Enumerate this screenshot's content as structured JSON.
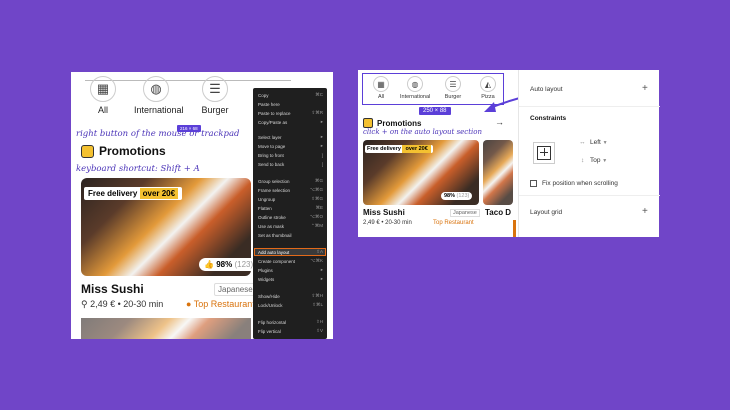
{
  "left": {
    "categories": [
      "All",
      "International",
      "Burger"
    ],
    "annotation_mouse": "right button of the mouse or trackpad",
    "size_tag": "216 × 68",
    "section_title": "Promotions",
    "annotation_shortcut": "keyboard shortcut: Shift + A",
    "delivery_label": "Free delivery",
    "delivery_value": "over 20€",
    "rating_value": "98%",
    "rating_count": "(123)",
    "card_title": "Miss Sushi",
    "card_tag": "Japanese",
    "card_meta": "2,49 € • 20-30 min",
    "card_top": "Top Restaurant"
  },
  "menu": {
    "items": [
      {
        "label": "Copy",
        "key": "⌘C"
      },
      {
        "label": "Paste here",
        "key": ""
      },
      {
        "label": "Paste to replace",
        "key": "⇧⌘R"
      },
      {
        "label": "Copy/Paste as",
        "key": "▸"
      },
      {
        "label": "Select layer",
        "key": "▸"
      },
      {
        "label": "Move to page",
        "key": "▸"
      },
      {
        "label": "Bring to front",
        "key": "]"
      },
      {
        "label": "Send to back",
        "key": "["
      },
      {
        "label": "Group selection",
        "key": "⌘G"
      },
      {
        "label": "Frame selection",
        "key": "⌥⌘G"
      },
      {
        "label": "Ungroup",
        "key": "⇧⌘G"
      },
      {
        "label": "Flatten",
        "key": "⌘E"
      },
      {
        "label": "Outline stroke",
        "key": "⌥⌘O"
      },
      {
        "label": "Use as mask",
        "key": "⌃⌘M"
      },
      {
        "label": "Set as thumbnail",
        "key": ""
      },
      {
        "label": "Add auto layout",
        "key": "⇧A"
      },
      {
        "label": "Create component",
        "key": "⌥⌘K"
      },
      {
        "label": "Plugins",
        "key": "▸"
      },
      {
        "label": "Widgets",
        "key": "▸"
      },
      {
        "label": "Show/Hide",
        "key": "⇧⌘H"
      },
      {
        "label": "Lock/Unlock",
        "key": "⇧⌘L"
      },
      {
        "label": "Flip horizontal",
        "key": "⇧H"
      },
      {
        "label": "Flip vertical",
        "key": "⇧V"
      }
    ]
  },
  "right": {
    "categories": [
      "All",
      "International",
      "Burger",
      "Pizza"
    ],
    "size_tag": "250 × 88",
    "section_title": "Promotions",
    "annotation": "click + on the auto layout section",
    "delivery_label": "Free delivery",
    "delivery_value": "over 20€",
    "rating_value": "98%",
    "rating_count": "(123)",
    "card_title": "Miss Sushi",
    "card_tag": "Japanese",
    "card_meta": "2,49 € • 20-30 min",
    "card_top": "Top Restaurant",
    "card2_title": "Taco D"
  },
  "props": {
    "auto_layout": "Auto layout",
    "constraints": "Constraints",
    "horizontal": "Left",
    "vertical": "Top",
    "fix_position": "Fix position when scrolling",
    "layout_grid": "Layout grid",
    "plus": "+"
  }
}
